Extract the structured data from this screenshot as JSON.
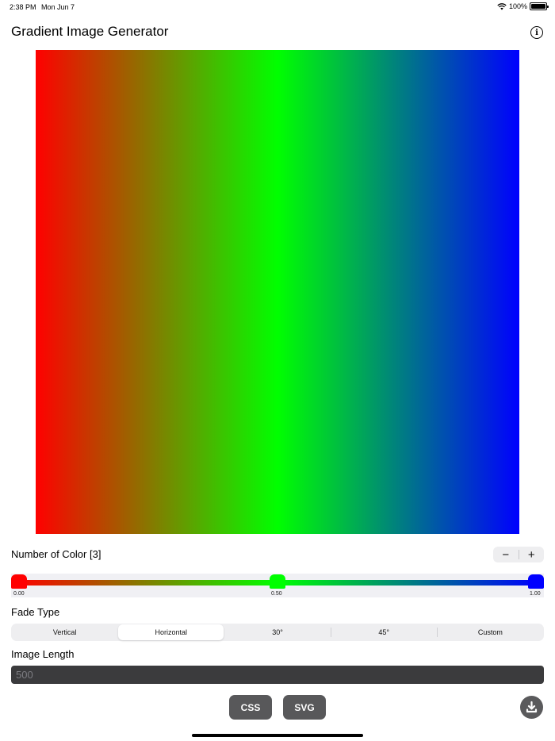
{
  "status_bar": {
    "time": "2:38 PM",
    "date": "Mon Jun 7",
    "battery": "100%",
    "icons": [
      "wifi-icon",
      "battery-icon"
    ]
  },
  "header": {
    "title": "Gradient Image Generator",
    "info_icon": "info-circle-icon"
  },
  "gradient": {
    "direction": "horizontal",
    "stops": [
      {
        "color": "#ff0000",
        "position": 0.0
      },
      {
        "color": "#00ff00",
        "position": 0.5
      },
      {
        "color": "#0000ff",
        "position": 1.0
      }
    ]
  },
  "colors_section": {
    "label": "Number of Color [3]",
    "minus": "−",
    "plus": "+"
  },
  "slider": {
    "values": [
      "0.00",
      "0.50",
      "1.00"
    ],
    "knob_colors": [
      "#ff0000",
      "#00ff00",
      "#0000ff"
    ]
  },
  "fade_type": {
    "label": "Fade Type",
    "options": [
      "Vertical",
      "Horizontal",
      "30°",
      "45°",
      "Custom"
    ],
    "selected": "Horizontal"
  },
  "image_length": {
    "label": "Image Length",
    "placeholder": "500",
    "value": ""
  },
  "actions": {
    "css_label": "CSS",
    "svg_label": "SVG",
    "download_icon": "download-icon"
  },
  "colors": {
    "button_bg": "#58585a",
    "input_bg": "#3b3b3d"
  }
}
